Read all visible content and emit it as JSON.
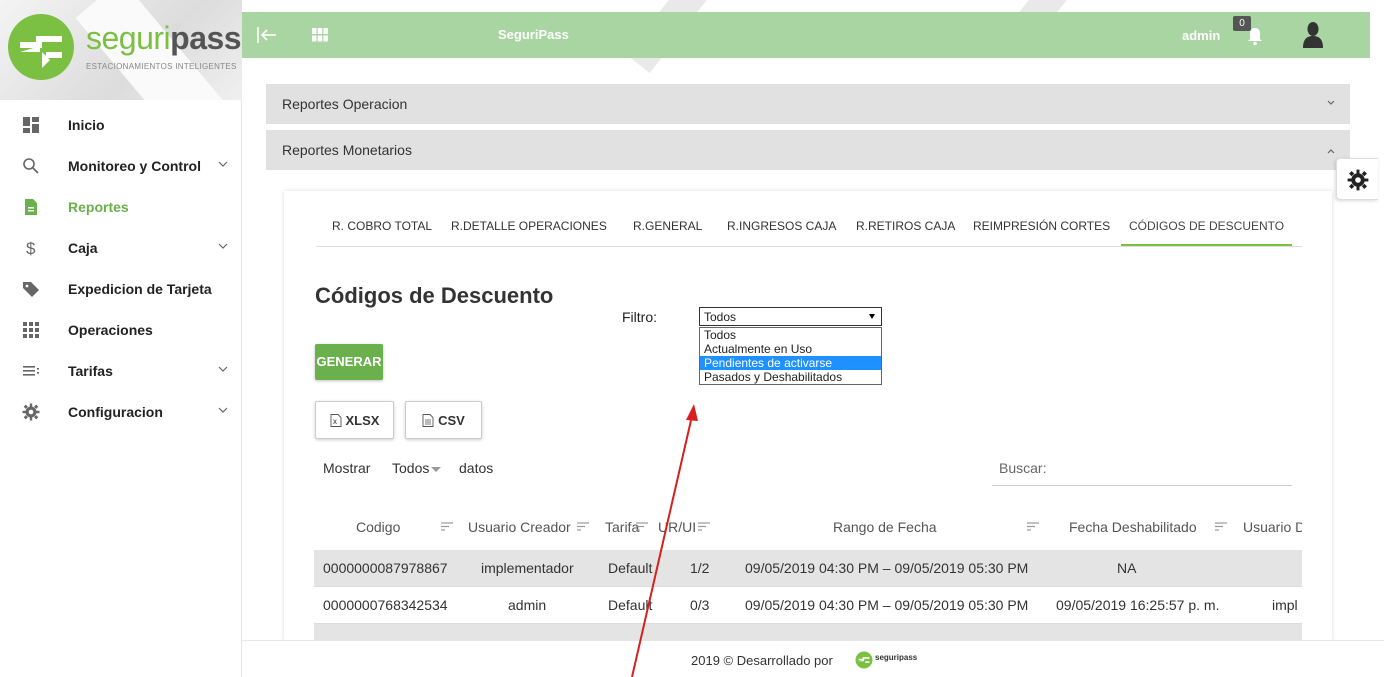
{
  "brand": {
    "logo_word_1": "seguri",
    "logo_word_2": "pass",
    "tagline": "ESTACIONAMIENTOS INTELIGENTES"
  },
  "sidebar": {
    "items": [
      {
        "label": "Inicio",
        "icon": "dashboard-icon",
        "active": false,
        "expandable": false
      },
      {
        "label": "Monitoreo y Control",
        "icon": "search-icon",
        "active": false,
        "expandable": true
      },
      {
        "label": "Reportes",
        "icon": "document-icon",
        "active": true,
        "expandable": false
      },
      {
        "label": "Caja",
        "icon": "dollar-icon",
        "active": false,
        "expandable": true
      },
      {
        "label": "Expedicion de Tarjeta",
        "icon": "tag-icon",
        "active": false,
        "expandable": false
      },
      {
        "label": "Operaciones",
        "icon": "grid-icon",
        "active": false,
        "expandable": false
      },
      {
        "label": "Tarifas",
        "icon": "list-icon",
        "active": false,
        "expandable": true
      },
      {
        "label": "Configuracion",
        "icon": "gear-icon",
        "active": false,
        "expandable": true
      }
    ]
  },
  "topbar": {
    "title": "SeguriPass",
    "user": "admin",
    "notification_count": "0",
    "bg_color": "#a8d5a2"
  },
  "accordion": {
    "operacion": "Reportes Operacion",
    "monetarios": "Reportes Monetarios"
  },
  "tabs": [
    "R. COBRO TOTAL",
    "R.DETALLE OPERACIONES",
    "R.GENERAL",
    "R.INGRESOS CAJA",
    "R.RETIROS CAJA",
    "REIMPRESIÓN CORTES",
    "CÓDIGOS DE DESCUENTO"
  ],
  "active_tab": "CÓDIGOS DE DESCUENTO",
  "section": {
    "title": "Códigos de Descuento",
    "filter_label": "Filtro:",
    "filter_value": "Todos",
    "filter_options": [
      "Todos",
      "Actualmente en Uso",
      "Pendientes de activarse",
      "Pasados y Deshabilitados"
    ],
    "filter_highlighted": "Pendientes de activarse",
    "generar_label": "GENERAR",
    "xlsx_label": "XLSX",
    "csv_label": "CSV",
    "show_label": "Mostrar",
    "show_value": "Todos",
    "datos_label": "datos",
    "search_label": "Buscar:"
  },
  "table": {
    "columns": [
      "Codigo",
      "Usuario Creador",
      "Tarifa",
      "UR/UI",
      "Rango de Fecha",
      "Fecha Deshabilitado",
      "Usuario D"
    ],
    "rows": [
      [
        "0000000087978867",
        "implementador",
        "Default",
        "1/2",
        "09/05/2019 04:30 PM – 09/05/2019 05:30 PM",
        "NA",
        ""
      ],
      [
        "0000000768342534",
        "admin",
        "Default",
        "0/3",
        "09/05/2019 04:30 PM – 09/05/2019 05:30 PM",
        "09/05/2019 16:25:57 p. m.",
        "impl"
      ]
    ]
  },
  "footer": {
    "text": "2019 © Desarrollado por",
    "logo_text": "seguripass"
  },
  "colors": {
    "accent_green": "#6ab04c",
    "highlight_blue": "#1e90ff",
    "arrow_red": "#d62020"
  }
}
